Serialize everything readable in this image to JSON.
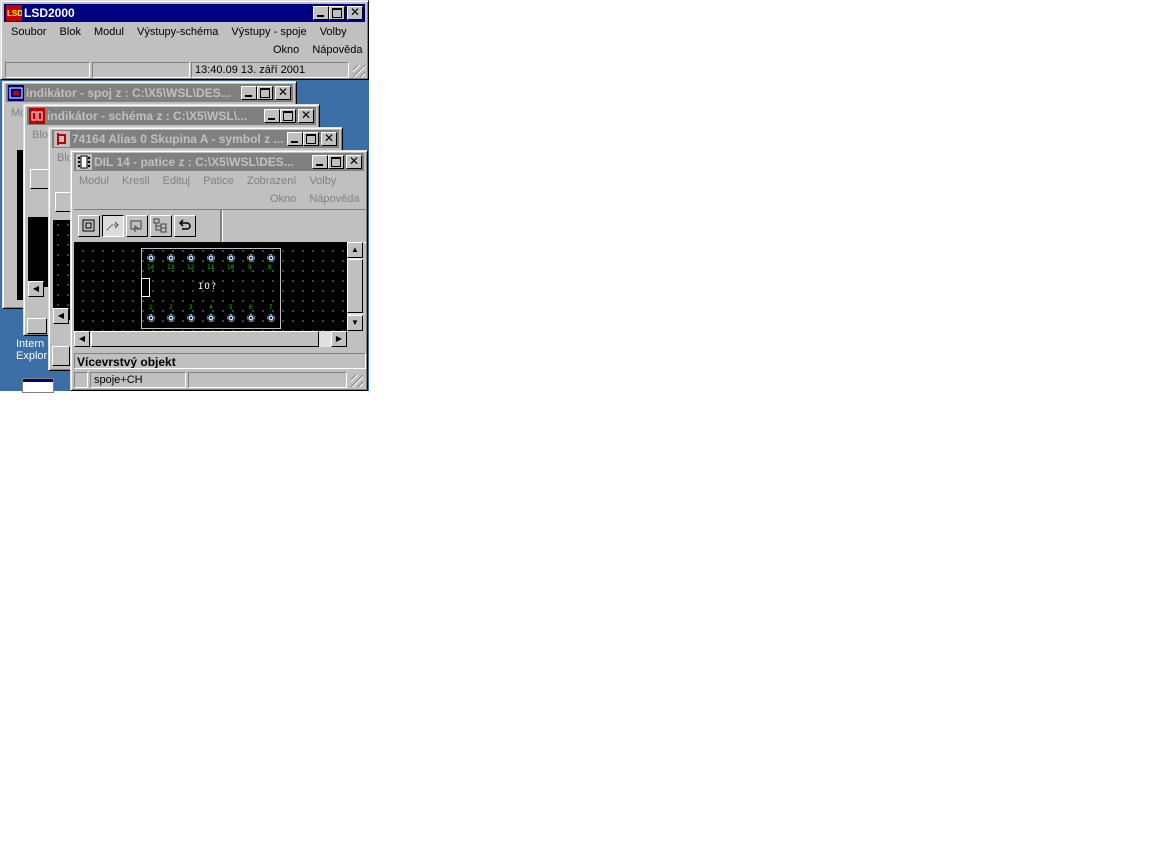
{
  "desktop": {
    "color": "#3a6ea5",
    "icon_label_line1": "Intern",
    "icon_label_line2": "Explor"
  },
  "main_window": {
    "title": "LSD2000",
    "menu_row1": [
      "Soubor",
      "Blok",
      "Modul",
      "Výstupy-schéma",
      "Výstupy - spoje",
      "Volby"
    ],
    "menu_row2": [
      "Okno",
      "Nápověda"
    ],
    "status_datetime": "13:40.09 13. září 2001"
  },
  "child_windows": [
    {
      "title": "indikátor - spoj z : C:\\X5\\WSL\\DES...",
      "menu_peek": "Mo",
      "icon": "pcb-icon"
    },
    {
      "title": "indikátor - schéma z : C:\\X5\\WSL\\...",
      "menu_peek": "Blo",
      "icon": "schema-icon"
    },
    {
      "title": "74164 Alias 0 Skupina A - symbol z ...",
      "menu_peek": "Blo",
      "icon": "symbol-icon"
    }
  ],
  "side_peek_text": "Vy",
  "active_child": {
    "title": "DIL 14 - patice z : C:\\X5\\WSL\\DES...",
    "menu_row1": [
      "Modul",
      "Kresli",
      "Edituj",
      "Patice",
      "Zobrazení",
      "Volby"
    ],
    "menu_row2": [
      "Okno",
      "Nápověda"
    ],
    "toolbar": [
      "zoom-fit-icon",
      "route-icon",
      "pad-place-icon",
      "tree-icon",
      "undo-icon"
    ],
    "package_label": "IO?",
    "top_pins": [
      "14",
      "13",
      "12",
      "11",
      "10",
      "9",
      "8"
    ],
    "bottom_pins": [
      "1",
      "2",
      "3",
      "4",
      "5",
      "6",
      "7"
    ],
    "layer_panel": "Vícevrstvý objekt",
    "status_layer": "spoje+CH"
  }
}
